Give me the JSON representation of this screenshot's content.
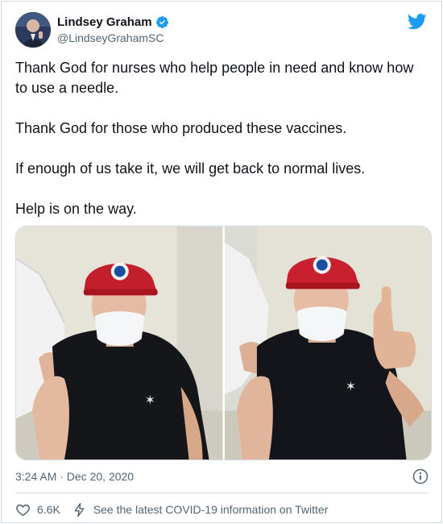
{
  "author": {
    "display_name": "Lindsey Graham",
    "handle": "@LindseyGrahamSC",
    "verified": true,
    "avatar_icon": "avatar-photo"
  },
  "brand": {
    "logo_icon": "twitter-bird-icon",
    "accent": "#1d9bf0"
  },
  "tweet": {
    "paragraphs": [
      "Thank God for nurses who help people in need and know how to use a needle.",
      "Thank God for those who produced these vaccines.",
      "If enough of us take it, we will get back to normal lives.",
      "Help is on the way."
    ]
  },
  "media": {
    "photos": [
      {
        "name": "photo-vaccination"
      },
      {
        "name": "photo-thumbs-up"
      }
    ]
  },
  "meta": {
    "timestamp": "3:24 AM · Dec 20, 2020",
    "info_icon": "info-icon"
  },
  "actions": {
    "like_count": "6.6K",
    "covid_info": "See the latest COVID-19 information on Twitter"
  }
}
